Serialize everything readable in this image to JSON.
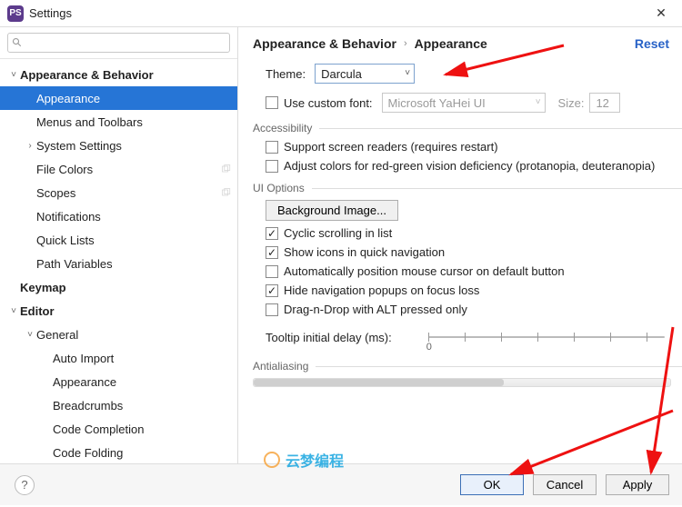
{
  "window": {
    "title": "Settings"
  },
  "search": {
    "placeholder": ""
  },
  "sidebar": {
    "items": [
      {
        "label": "Appearance & Behavior",
        "bold": true,
        "depth": 0,
        "expandable": true,
        "expanded": true
      },
      {
        "label": "Appearance",
        "depth": 1,
        "selected": true
      },
      {
        "label": "Menus and Toolbars",
        "depth": 1
      },
      {
        "label": "System Settings",
        "depth": 1,
        "expandable": true,
        "expanded": false
      },
      {
        "label": "File Colors",
        "depth": 1,
        "project": true
      },
      {
        "label": "Scopes",
        "depth": 1,
        "project": true
      },
      {
        "label": "Notifications",
        "depth": 1
      },
      {
        "label": "Quick Lists",
        "depth": 1
      },
      {
        "label": "Path Variables",
        "depth": 1
      },
      {
        "label": "Keymap",
        "bold": true,
        "depth": 0
      },
      {
        "label": "Editor",
        "bold": true,
        "depth": 0,
        "expandable": true,
        "expanded": true
      },
      {
        "label": "General",
        "depth": 1,
        "expandable": true,
        "expanded": true
      },
      {
        "label": "Auto Import",
        "depth": 2
      },
      {
        "label": "Appearance",
        "depth": 2
      },
      {
        "label": "Breadcrumbs",
        "depth": 2
      },
      {
        "label": "Code Completion",
        "depth": 2
      },
      {
        "label": "Code Folding",
        "depth": 2
      }
    ]
  },
  "breadcrumb": {
    "root": "Appearance & Behavior",
    "leaf": "Appearance",
    "reset": "Reset"
  },
  "theme": {
    "label": "Theme:",
    "value": "Darcula"
  },
  "customFont": {
    "label": "Use custom font:",
    "checked": false,
    "fontValue": "Microsoft YaHei UI",
    "sizeLabel": "Size:",
    "sizeValue": "12"
  },
  "groups": {
    "accessibility": "Accessibility",
    "uiOptions": "UI Options",
    "antialiasing": "Antialiasing"
  },
  "accessibility": {
    "screenReaders": {
      "label": "Support screen readers (requires restart)",
      "checked": false
    },
    "colorDef": {
      "label": "Adjust colors for red-green vision deficiency (protanopia, deuteranopia)",
      "checked": false
    }
  },
  "uiOptions": {
    "bgImageBtn": "Background Image...",
    "cyclic": {
      "label": "Cyclic scrolling in list",
      "checked": true
    },
    "showIcons": {
      "label": "Show icons in quick navigation",
      "checked": true
    },
    "autoCursor": {
      "label": "Automatically position mouse cursor on default button",
      "checked": false
    },
    "hideNav": {
      "label": "Hide navigation popups on focus loss",
      "checked": true
    },
    "dragAlt": {
      "label": "Drag-n-Drop with ALT pressed only",
      "checked": false
    },
    "tooltipLabel": "Tooltip initial delay (ms):",
    "tooltipMin": "0"
  },
  "footer": {
    "ok": "OK",
    "cancel": "Cancel",
    "apply": "Apply"
  },
  "watermark": "云梦编程"
}
